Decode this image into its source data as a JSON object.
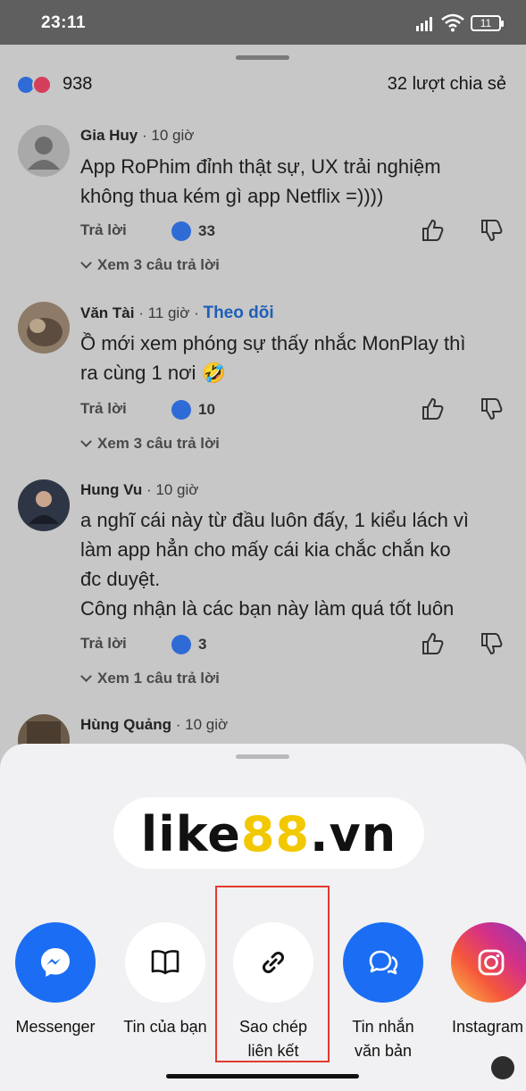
{
  "status": {
    "time": "23:11",
    "battery": "11"
  },
  "post": {
    "reaction_count": "938",
    "shares": "32 lượt chia sẻ"
  },
  "comments": [
    {
      "name": "Gia Huy",
      "time": "10 giờ",
      "follow": "",
      "lines": [
        "App RoPhim đỉnh thật sự, UX trải nghiệm",
        "không thua kém gì app Netflix =))))"
      ],
      "reply": "Trả lời",
      "likes": "33",
      "view_replies": "Xem 3 câu trả lời"
    },
    {
      "name": "Văn Tài",
      "time": "11 giờ",
      "follow": "Theo dõi",
      "lines": [
        "Ồ mới xem phóng sự thấy nhắc MonPlay thì",
        "ra cùng 1 nơi 🤣"
      ],
      "reply": "Trả lời",
      "likes": "10",
      "view_replies": "Xem 3 câu trả lời"
    },
    {
      "name": "Hung Vu",
      "time": "10 giờ",
      "follow": "",
      "lines": [
        "a nghĩ cái này từ đầu luôn đấy, 1 kiểu lách vì",
        "làm app hẳn cho mấy cái kia chắc chắn ko",
        "đc duyệt.",
        "Công nhận là các bạn này làm quá tốt luôn"
      ],
      "reply": "Trả lời",
      "likes": "3",
      "view_replies": "Xem 1 câu trả lời"
    },
    {
      "name": "Hùng Quảng",
      "time": "10 giờ"
    }
  ],
  "banner": {
    "part1": "like",
    "part2": "88",
    "part3": ".vn"
  },
  "share_options": [
    {
      "label": "Messenger",
      "icon": "messenger-icon"
    },
    {
      "label": "Tin của bạn",
      "icon": "book-icon"
    },
    {
      "label": "Sao chép liên kết",
      "label_line1": "Sao chép",
      "label_line2": "liên kết",
      "icon": "link-icon"
    },
    {
      "label": "Tin nhắn văn bản",
      "label_line1": "Tin nhắn",
      "label_line2": "văn bản",
      "icon": "chat-bubbles-icon"
    },
    {
      "label": "Instagram",
      "icon": "instagram-icon"
    }
  ],
  "colors": {
    "facebook_blue": "#1b6ef3",
    "highlight_red": "#e23a2f",
    "banner_accent": "#f2c800",
    "follow_link": "#1e5fb8"
  }
}
